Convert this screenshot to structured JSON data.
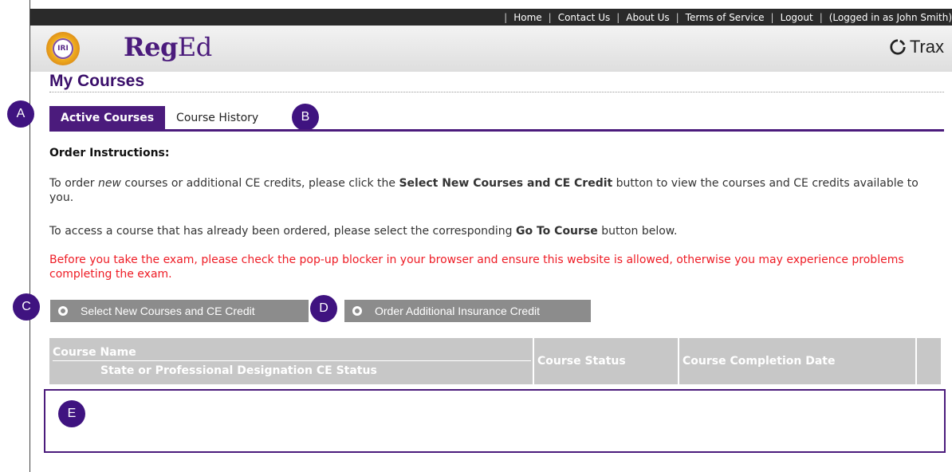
{
  "topnav": {
    "items": [
      "Home",
      "Contact Us",
      "About Us",
      "Terms of Service",
      "Logout"
    ],
    "logged_in": "(Logged in as John  Smith)"
  },
  "header": {
    "seal_text": "IRI",
    "brand_bold": "Reg",
    "brand_light": "Ed",
    "trax_label": "Trax"
  },
  "page": {
    "title": "My Courses"
  },
  "tabs": [
    {
      "label": "Active Courses",
      "active": true
    },
    {
      "label": "Course History",
      "active": false
    }
  ],
  "instructions": {
    "title": "Order Instructions:",
    "p1_a": "To order ",
    "p1_em": "new",
    "p1_b": " courses or additional CE credits, please click the ",
    "p1_strong": "Select New Courses and CE Credit",
    "p1_c": " button to view the courses and CE credits available to you.",
    "p2_a": "To access a course that has already been ordered, please select the corresponding ",
    "p2_strong": "Go To Course",
    "p2_b": " button below.",
    "warning": "Before you take the exam, please check the pop-up blocker in your browser and ensure this website is allowed, otherwise you may experience problems completing the exam."
  },
  "buttons": {
    "select_new": "Select New Courses and CE Credit",
    "order_additional": "Order Additional Insurance Credit"
  },
  "table": {
    "col_course": "Course Name",
    "col_course_sub": "State or Professional Designation CE Status",
    "col_status": "Course Status",
    "col_date": "Course Completion Date"
  },
  "badges": {
    "a": "A",
    "b": "B",
    "c": "C",
    "d": "D",
    "e": "E"
  },
  "colors": {
    "accent": "#4b1b7c",
    "badge": "#3f1380",
    "warning": "#ee1c25",
    "button": "#8c8c8c"
  }
}
